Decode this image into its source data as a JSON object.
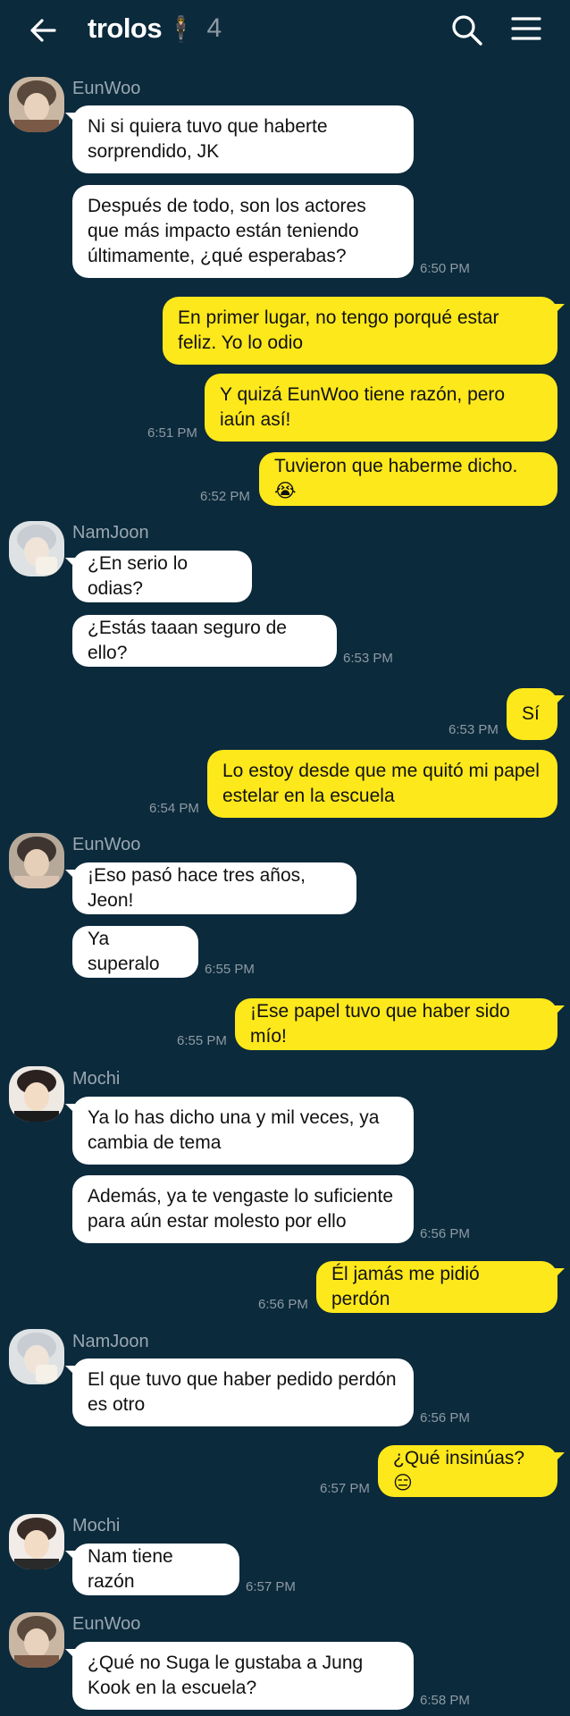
{
  "header": {
    "title": "trolos",
    "title_emoji": "🕴",
    "member_count": "4",
    "back_icon": "arrow-left-icon",
    "search_icon": "search-icon",
    "menu_icon": "hamburger-menu-icon"
  },
  "colors": {
    "background": "#0b2a3c",
    "incoming_bubble": "#ffffff",
    "outgoing_bubble": "#fde81b",
    "meta_text": "#8e9aa3"
  },
  "messages": [
    {
      "sender": "EunWoo",
      "text": "Ni si quiera tuvo que haberte sorprendido, JK"
    },
    {
      "sender": "EunWoo",
      "text": "Después de todo, son los actores que más impacto están teniendo últimamente, ¿qué esperabas?",
      "time": "6:50 PM"
    },
    {
      "sender": "me",
      "text": "En primer lugar, no tengo porqué estar feliz. Yo lo odio"
    },
    {
      "sender": "me",
      "text": "Y quizá EunWoo tiene razón, pero iaún así!",
      "time": "6:51 PM"
    },
    {
      "sender": "me",
      "text": "Tuvieron que haberme dicho. 😭",
      "time": "6:52 PM"
    },
    {
      "sender": "NamJoon",
      "text": "¿En serio lo odias?"
    },
    {
      "sender": "NamJoon",
      "text": "¿Estás taaan seguro de ello?",
      "time": "6:53 PM"
    },
    {
      "sender": "me",
      "text": "Sí",
      "time": "6:53 PM"
    },
    {
      "sender": "me",
      "text": "Lo estoy desde que me quitó mi papel estelar en la escuela",
      "time": "6:54 PM"
    },
    {
      "sender": "EunWoo",
      "text": "¡Eso pasó hace tres años, Jeon!"
    },
    {
      "sender": "EunWoo",
      "text": "Ya superalo",
      "time": "6:55 PM"
    },
    {
      "sender": "me",
      "text": "¡Ese papel tuvo que haber sido mío!",
      "time": "6:55 PM"
    },
    {
      "sender": "Mochi",
      "text": "Ya lo has dicho una y mil veces, ya cambia de tema"
    },
    {
      "sender": "Mochi",
      "text": "Además, ya te vengaste lo suficiente para aún estar molesto por ello",
      "time": "6:56 PM"
    },
    {
      "sender": "me",
      "text": "Él jamás me pidió perdón",
      "time": "6:56 PM"
    },
    {
      "sender": "NamJoon",
      "text": "El que tuvo que haber pedido perdón es otro",
      "time": "6:56 PM"
    },
    {
      "sender": "me",
      "text": "¿Qué insinúas? 😑",
      "time": "6:57 PM"
    },
    {
      "sender": "Mochi",
      "text": "Nam tiene razón",
      "time": "6:57 PM"
    },
    {
      "sender": "EunWoo",
      "text": "¿Qué no Suga le gustaba a Jung Kook en la escuela?",
      "time": "6:58 PM"
    }
  ]
}
